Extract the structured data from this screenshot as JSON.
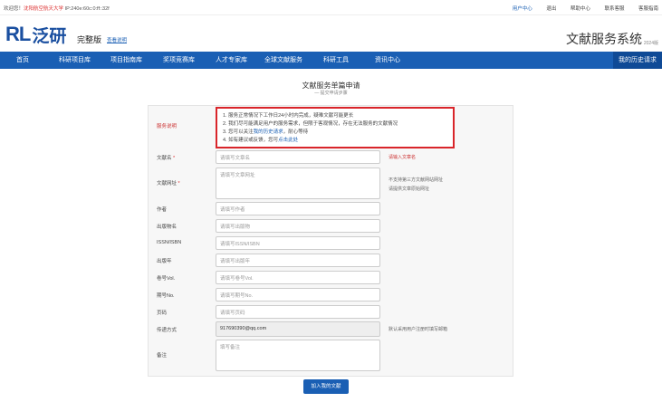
{
  "topbar": {
    "welcome": "欢迎您！",
    "university": "沈阳航空航天大学",
    "ip": " IP:240e:60c:0:ff::32f",
    "links": [
      "用户中心",
      "退出",
      "帮助中心",
      "联系客服",
      "客服指南"
    ]
  },
  "header": {
    "logo_mark": "RL",
    "logo_text": "泛研",
    "edition": "完整版",
    "edition_link": "查看说明",
    "system_title": "文献服务系统",
    "year": "2024版"
  },
  "nav": {
    "items": [
      "首页",
      "科研项目库",
      "项目指南库",
      "奖项竞赛库",
      "人才专家库",
      "全球文献服务",
      "科研工具",
      "资讯中心"
    ],
    "history": "我的历史请求"
  },
  "form": {
    "title": "文献服务单篇申请",
    "subtitle": "— 提交申请步骤",
    "service_label": "服务说明",
    "notice_lines": [
      "1. 服务正常情况下工作日24小时内完成，疑难文献可能更长",
      "2. 我们尽可能满足用户的服务需求，但限于客观情况，存在无法服务的文献情况",
      "3. 您可以关注",
      "4. 如有建议或反馈，您可"
    ],
    "notice_link3": "我的历史请求",
    "notice_tail3": "，耐心等待",
    "notice_link4": "点击此处",
    "fields": {
      "title_label": "文献名",
      "title_ph": "请填写文章名",
      "title_hint": "请输入文章名",
      "url_label": "文献网址",
      "url_ph": "请填写文章网址",
      "url_hint1": "不支持第三方文献网站网址",
      "url_hint2": "请提供文章原始网址",
      "author_label": "作者",
      "author_ph": "请填写作者",
      "pub_label": "出版物名",
      "pub_ph": "请填写出版物",
      "issn_label": "ISSN/ISBN",
      "issn_ph": "请填写ISSN/ISBN",
      "year_label": "出版年",
      "year_ph": "请填写出版年",
      "vol_label": "卷号Vol.",
      "vol_ph": "请填写卷号Vol.",
      "no_label": "期号No.",
      "no_ph": "请填写期号No.",
      "page_label": "页码",
      "page_ph": "请填写页码",
      "delivery_label": "传递方式",
      "delivery_value": "917690390@qq.com",
      "delivery_hint": "默认采用用户注册时填写邮箱",
      "remark_label": "备注",
      "remark_ph": "填写备注"
    },
    "submit": "加入我的文献"
  }
}
